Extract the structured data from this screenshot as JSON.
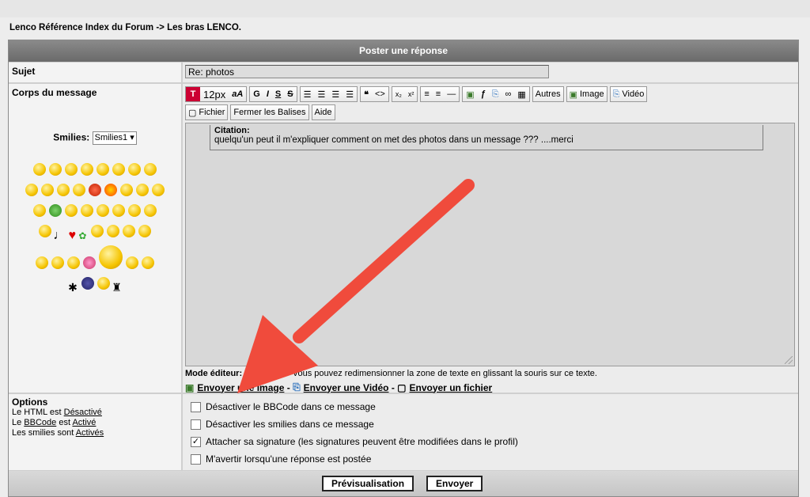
{
  "breadcrumb": {
    "home": "Lenco Référence Index du Forum",
    "sep": " -> ",
    "forum": "Les bras LENCO."
  },
  "form": {
    "title": "Poster une réponse"
  },
  "subject": {
    "label": "Sujet",
    "value": "Re: photos"
  },
  "body": {
    "label": "Corps du message"
  },
  "smilies": {
    "label": "Smilies:",
    "selected": "Smilies1"
  },
  "toolbar": {
    "size": "12px",
    "bold": "G",
    "italic": "I",
    "strike": "S",
    "underline": "S",
    "autres": "Autres",
    "image": "Image",
    "video": "Vidéo",
    "fichier": "Fichier",
    "fermer": "Fermer les Balises",
    "aide": "Aide"
  },
  "editor": {
    "quote_title": "Citation:",
    "quote_text": "quelqu'un peut il m'expliquer comment on met des photos dans un message ??? ....merci"
  },
  "mode": {
    "label": "Mode éditeur:",
    "text": " O",
    "hint": "Vous pouvez redimensionner la zone de texte en glissant la souris sur ce texte."
  },
  "links": {
    "image": "Envoyer une Image",
    "video": "Envoyer une Vidéo",
    "file": "Envoyer un fichier",
    "sep": " - "
  },
  "options": {
    "title": "Options",
    "html_prefix": "Le HTML est ",
    "html_state": "Désactivé",
    "bbcode_prefix": "Le ",
    "bbcode_link": "BBCode",
    "bbcode_mid": " est ",
    "bbcode_state": "Activé",
    "smilies_prefix": "Les smilies sont ",
    "smilies_state": "Activés",
    "checks": [
      {
        "label": "Désactiver le BBCode dans ce message",
        "checked": false
      },
      {
        "label": "Désactiver les smilies dans ce message",
        "checked": false
      },
      {
        "label": "Attacher sa signature (les signatures peuvent être modifiées dans le profil)",
        "checked": true
      },
      {
        "label": "M'avertir lorsqu'une réponse est postée",
        "checked": false
      }
    ]
  },
  "buttons": {
    "preview": "Prévisualisation",
    "send": "Envoyer"
  },
  "colors": {
    "arrow": "#f04b3c",
    "titlebar": "#7a7a7a"
  }
}
